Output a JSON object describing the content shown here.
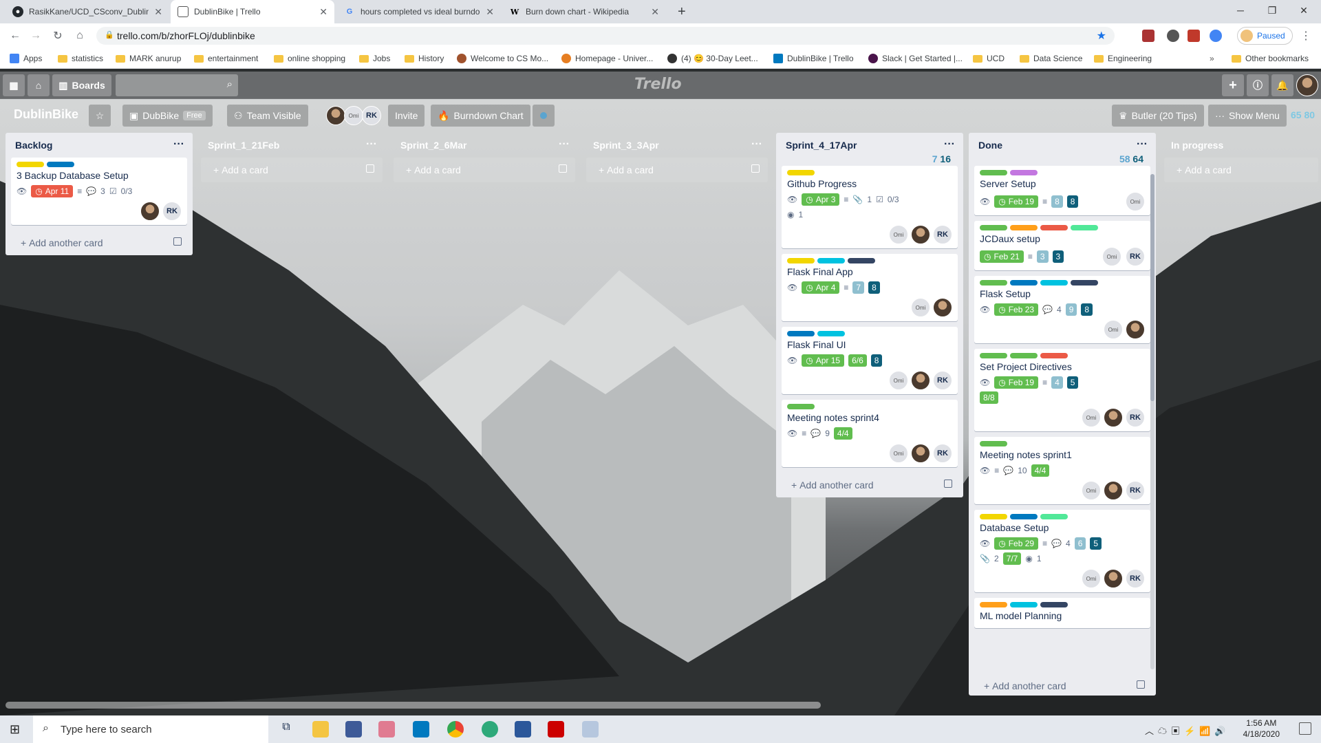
{
  "browser": {
    "tabs": [
      {
        "title": "RasikKane/UCD_CSconv_DublinB",
        "icon": "github-icon"
      },
      {
        "title": "DublinBike | Trello",
        "icon": "trello-icon",
        "active": true
      },
      {
        "title": "hours completed vs ideal burndo",
        "icon": "google-icon"
      },
      {
        "title": "Burn down chart - Wikipedia",
        "icon": "wikipedia-icon"
      }
    ],
    "url": "trello.com/b/zhorFLOj/dublinbike",
    "profile": "Paused",
    "bookmarks": [
      "Apps",
      "statistics",
      "MARK anurup",
      "entertainment",
      "online shopping",
      "Jobs",
      "History",
      "Welcome to CS Mo...",
      "Homepage - Univer...",
      "(4) 😊 30-Day Leet...",
      "DublinBike | Trello",
      "Slack | Get Started |...",
      "UCD",
      "Data Science",
      "Engineering",
      "Other bookmarks"
    ]
  },
  "header": {
    "boards": "Boards",
    "logo": "Trello"
  },
  "board": {
    "title": "DublinBike",
    "team": "DubBike",
    "plan": "Free",
    "visibility": "Team Visible",
    "invite": "Invite",
    "burndown": "Burndown Chart",
    "butler": "Butler (20 Tips)",
    "show_menu": "Show Menu",
    "points_a": "65",
    "points_b": "80",
    "member_rk": "RK",
    "member_omi": "Omi"
  },
  "lists": {
    "backlog": {
      "title": "Backlog",
      "add": "Add another card",
      "card": {
        "title": "3 Backup Database Setup",
        "due": "Apr 11",
        "comments": "3",
        "checklist": "0/3"
      }
    },
    "sprint1": {
      "title": "Sprint_1_21Feb",
      "add": "Add a card"
    },
    "sprint2": {
      "title": "Sprint_2_6Mar",
      "add": "Add a card"
    },
    "sprint3": {
      "title": "Sprint_3_3Apr",
      "add": "Add a card"
    },
    "sprint4": {
      "title": "Sprint_4_17Apr",
      "count_a": "7",
      "count_b": "16",
      "add": "Add another card",
      "cards": [
        {
          "title": "Github Progress",
          "due": "Apr 3",
          "attach": "1",
          "checklist": "0/3",
          "github": "1"
        },
        {
          "title": "Flask Final App",
          "due": "Apr 4",
          "p1": "7",
          "p2": "8"
        },
        {
          "title": "Flask Final UI",
          "due": "Apr 15",
          "checklist": "6/6",
          "p2": "8"
        },
        {
          "title": "Meeting notes sprint4",
          "comments": "9",
          "checklist": "4/4"
        }
      ]
    },
    "done": {
      "title": "Done",
      "count_a": "58",
      "count_b": "64",
      "add": "Add another card",
      "cards": [
        {
          "title": "Server Setup",
          "due": "Feb 19",
          "p1": "8",
          "p2": "8"
        },
        {
          "title": "JCDaux setup",
          "due": "Feb 21",
          "p1": "3",
          "p2": "3"
        },
        {
          "title": "Flask Setup",
          "due": "Feb 23",
          "comments": "4",
          "p1": "9",
          "p2": "8"
        },
        {
          "title": "Set Project Directives",
          "due": "Feb 19",
          "p1": "4",
          "p2": "5",
          "checklist": "8/8"
        },
        {
          "title": "Meeting notes sprint1",
          "comments": "10",
          "checklist": "4/4"
        },
        {
          "title": "Database Setup",
          "due": "Feb 29",
          "comments": "4",
          "p1": "6",
          "p2": "5",
          "attach": "2",
          "checklist": "7/7",
          "github": "1"
        },
        {
          "title": "ML model Planning"
        }
      ]
    },
    "inprogress": {
      "title": "In progress",
      "add": "Add a card"
    }
  },
  "taskbar": {
    "search": "Type here to search",
    "time": "1:56 AM",
    "date": "4/18/2020"
  },
  "colors": {
    "green": "#61bd4f",
    "yellow": "#f2d600",
    "orange": "#ff9f1a",
    "red": "#eb5a46",
    "purple": "#c377e0",
    "blue": "#0079bf",
    "sky": "#00c2e0",
    "lime": "#51e898",
    "black": "#344563"
  }
}
